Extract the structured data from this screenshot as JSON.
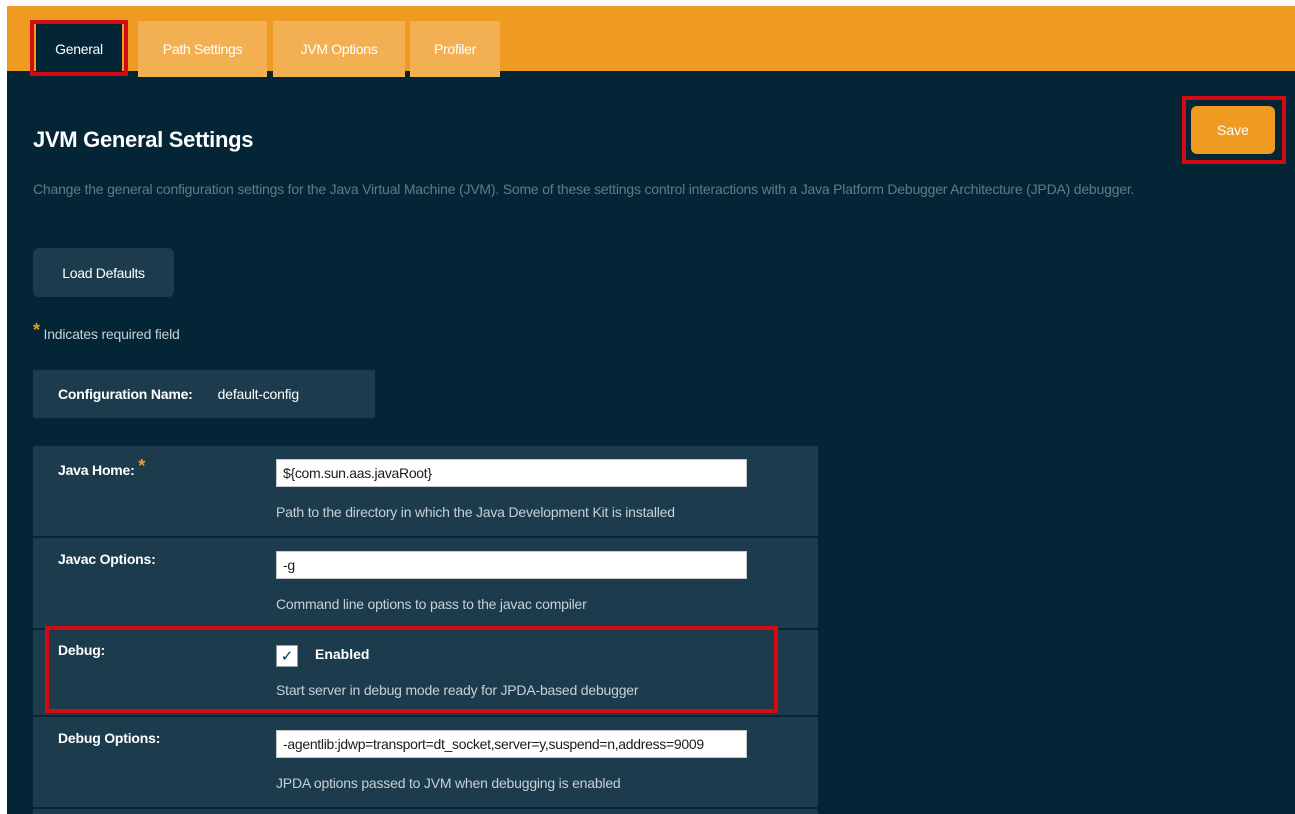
{
  "tabs": [
    {
      "label": "General",
      "active": true
    },
    {
      "label": "Path Settings",
      "active": false
    },
    {
      "label": "JVM Options",
      "active": false
    },
    {
      "label": "Profiler",
      "active": false
    }
  ],
  "page": {
    "title": "JVM General Settings",
    "description": "Change the general configuration settings for the Java Virtual Machine (JVM). Some of these settings control interactions with a Java Platform Debugger Architecture (JPDA) debugger.",
    "save_label": "Save",
    "load_defaults_label": "Load Defaults",
    "required_note": "Indicates required field",
    "required_marker": "*"
  },
  "config": {
    "label": "Configuration Name:",
    "value": "default-config"
  },
  "fields": {
    "java_home": {
      "label": "Java Home:",
      "value": "${com.sun.aas.javaRoot}",
      "help": "Path to the directory in which the Java Development Kit is installed"
    },
    "javac_options": {
      "label": "Javac Options:",
      "value": "-g",
      "help": "Command line options to pass to the javac compiler"
    },
    "debug": {
      "label": "Debug:",
      "checked": true,
      "check_glyph": "✓",
      "checkbox_label": "Enabled",
      "help": "Start server in debug mode ready for JPDA-based debugger"
    },
    "debug_options": {
      "label": "Debug Options:",
      "value": "-agentlib:jdwp=transport=dt_socket,server=y,suspend=n,address=9009",
      "help": "JPDA options passed to JVM when debugging is enabled"
    }
  },
  "colors": {
    "accent": "#ef9a21",
    "background": "#032536",
    "panel": "#1c3c4e",
    "highlight": "#d10c14"
  }
}
